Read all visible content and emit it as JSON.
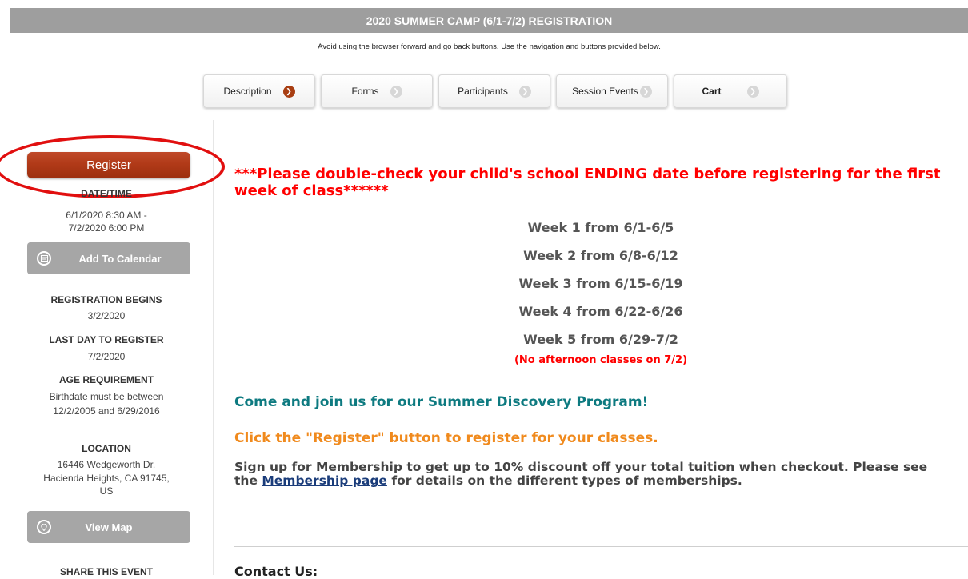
{
  "header": {
    "title": "2020 SUMMER CAMP (6/1-7/2) REGISTRATION",
    "notice": "Avoid using the browser forward and go back buttons. Use the navigation and buttons provided below."
  },
  "steps": [
    {
      "label": "Description",
      "active": true
    },
    {
      "label": "Forms",
      "active": false
    },
    {
      "label": "Participants",
      "active": false
    },
    {
      "label": "Session Events",
      "active": false
    },
    {
      "label": "Cart",
      "active": false
    }
  ],
  "sidebar": {
    "register_label": "Register",
    "datetime_head": "DATE/TIME",
    "datetime_line1": "6/1/2020 8:30 AM -",
    "datetime_line2": "7/2/2020 6:00 PM",
    "calendar_label": "Add To Calendar",
    "reg_begins_head": "REGISTRATION BEGINS",
    "reg_begins": "3/2/2020",
    "last_day_head": "LAST DAY TO REGISTER",
    "last_day": "7/2/2020",
    "age_head": "AGE REQUIREMENT",
    "age_line1": "Birthdate must be between",
    "age_line2": "12/2/2005 and 6/29/2016",
    "location_head": "LOCATION",
    "location_line1": "16446 Wedgeworth Dr.",
    "location_line2": "Hacienda Heights, CA 91745,",
    "location_line3": "US",
    "map_label": "View Map",
    "share_head": "SHARE THIS EVENT"
  },
  "content": {
    "warning": "***Please double-check your child's school ENDING date before registering for the first week of class******",
    "weeks": [
      "Week 1 from 6/1-6/5",
      "Week 2 from 6/8-6/12",
      "Week 3 from 6/15-6/19",
      "Week 4 from 6/22-6/26",
      "Week 5 from 6/29-7/2"
    ],
    "no_afternoon": "(No afternoon classes on 7/2)",
    "join": "Come and join us for our Summer Discovery Program!",
    "click": "Click the \"Register\" button to register for your classes.",
    "member_before": "Sign up for Membership to get up to 10% discount off your total tuition when checkout. Please see the ",
    "member_link": "Membership page",
    "member_after": " for details on the different types of memberships.",
    "contact": "Contact Us:"
  },
  "colors": {
    "register": "#b13a18",
    "warning": "#ff0000",
    "join": "#0d7a80",
    "click": "#f08a1d",
    "highlight_ring": "#e10f0f"
  }
}
